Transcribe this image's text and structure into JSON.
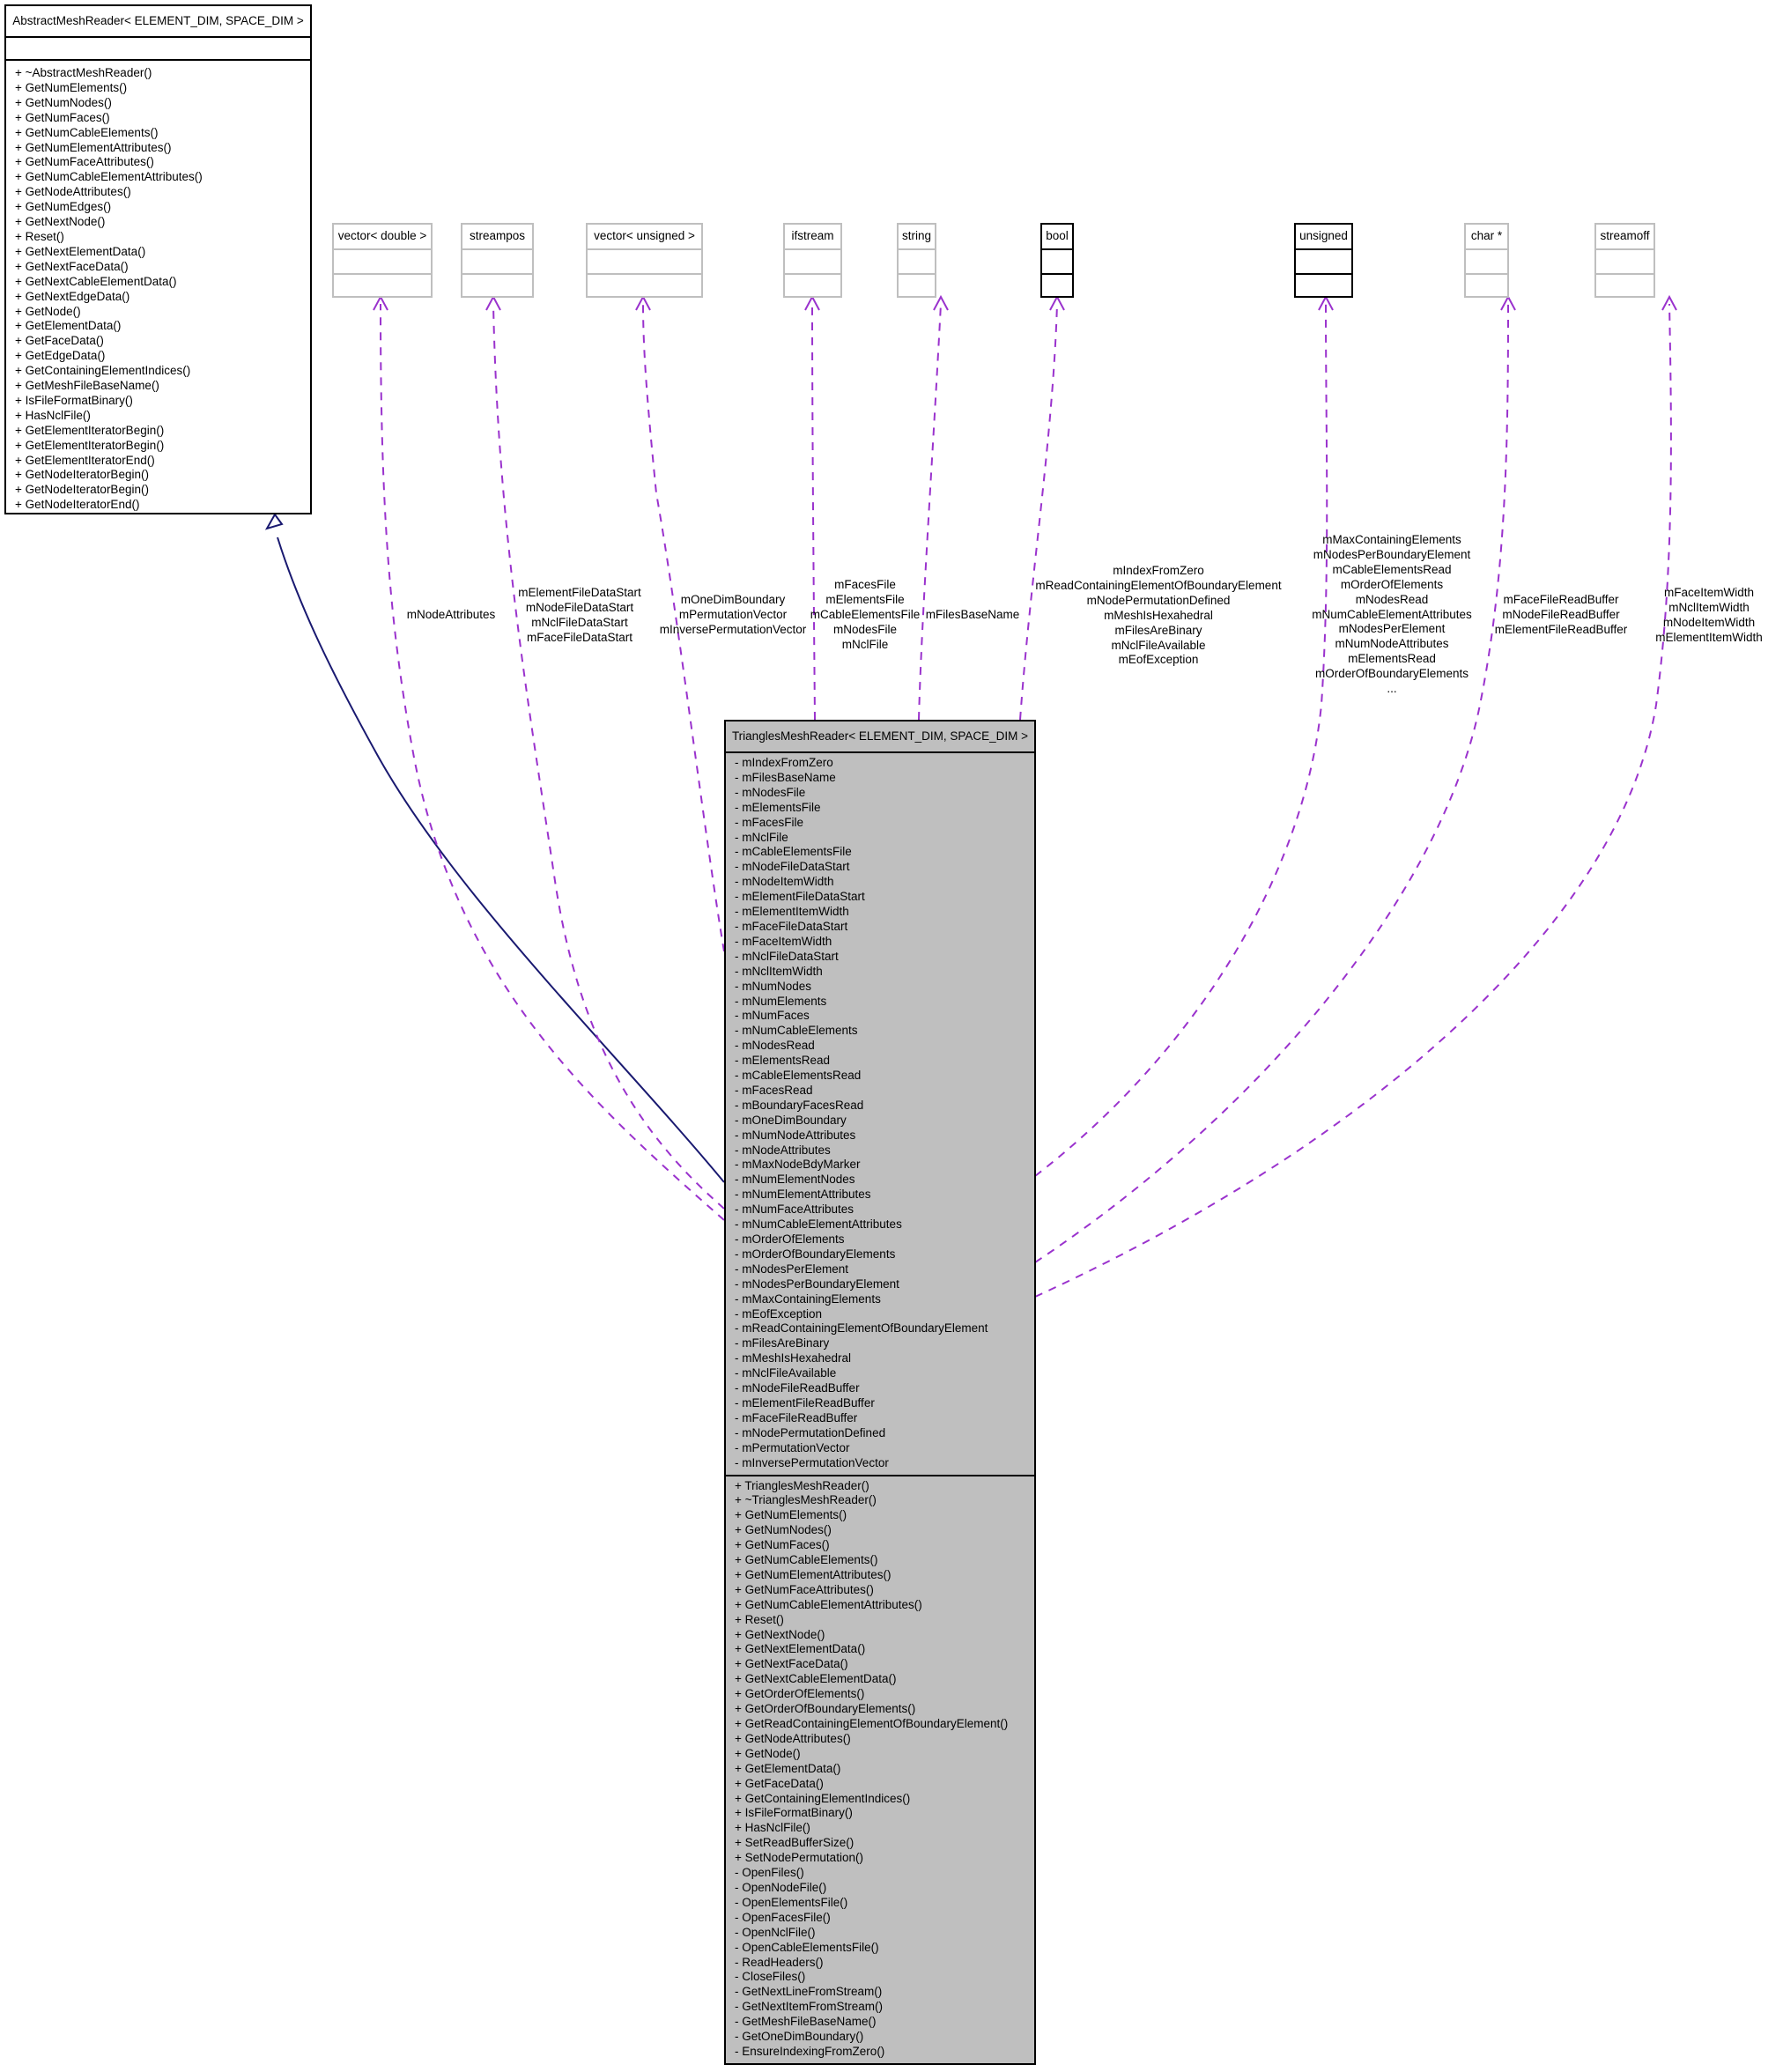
{
  "base_class": {
    "title": "AbstractMeshReader< ELEMENT_DIM, SPACE_DIM >",
    "attributes": [],
    "methods": [
      "+ ~AbstractMeshReader()",
      "+ GetNumElements()",
      "+ GetNumNodes()",
      "+ GetNumFaces()",
      "+ GetNumCableElements()",
      "+ GetNumElementAttributes()",
      "+ GetNumFaceAttributes()",
      "+ GetNumCableElementAttributes()",
      "+ GetNodeAttributes()",
      "+ GetNumEdges()",
      "+ GetNextNode()",
      "+ Reset()",
      "+ GetNextElementData()",
      "+ GetNextFaceData()",
      "+ GetNextCableElementData()",
      "+ GetNextEdgeData()",
      "+ GetNode()",
      "+ GetElementData()",
      "+ GetFaceData()",
      "+ GetEdgeData()",
      "+ GetContainingElementIndices()",
      "+ GetMeshFileBaseName()",
      "+ IsFileFormatBinary()",
      "+ HasNclFile()",
      "+ GetElementIteratorBegin()",
      "+ GetElementIteratorBegin()",
      "+ GetElementIteratorEnd()",
      "+ GetNodeIteratorBegin()",
      "+ GetNodeIteratorBegin()",
      "+ GetNodeIteratorEnd()"
    ]
  },
  "type_boxes": [
    {
      "id": "vector-double",
      "title": "vector< double >",
      "style": "gray"
    },
    {
      "id": "streampos",
      "title": "streampos",
      "style": "gray"
    },
    {
      "id": "vector-unsigned",
      "title": "vector< unsigned >",
      "style": "gray"
    },
    {
      "id": "ifstream",
      "title": "ifstream",
      "style": "gray"
    },
    {
      "id": "string",
      "title": "string",
      "style": "gray"
    },
    {
      "id": "bool",
      "title": "bool",
      "style": "black"
    },
    {
      "id": "unsigned",
      "title": "unsigned",
      "style": "black"
    },
    {
      "id": "char-ptr",
      "title": "char *",
      "style": "gray"
    },
    {
      "id": "streamoff",
      "title": "streamoff",
      "style": "gray"
    }
  ],
  "edge_labels": {
    "vector-double": [
      "mNodeAttributes"
    ],
    "streampos": [
      "mElementFileDataStart",
      "mNodeFileDataStart",
      "mNclFileDataStart",
      "mFaceFileDataStart"
    ],
    "vector-unsigned": [
      "mOneDimBoundary",
      "mPermutationVector",
      "mInversePermutationVector"
    ],
    "ifstream": [
      "mFacesFile",
      "mElementsFile",
      "mCableElementsFile",
      "mNodesFile",
      "mNclFile"
    ],
    "string": [
      "mFilesBaseName"
    ],
    "bool": [
      "mIndexFromZero",
      "mReadContainingElementOfBoundaryElement",
      "mNodePermutationDefined",
      "mMeshIsHexahedral",
      "mFilesAreBinary",
      "mNclFileAvailable",
      "mEofException"
    ],
    "unsigned": [
      "mMaxContainingElements",
      "mNodesPerBoundaryElement",
      "mCableElementsRead",
      "mOrderOfElements",
      "mNodesRead",
      "mNumCableElementAttributes",
      "mNodesPerElement",
      "mNumNodeAttributes",
      "mElementsRead",
      "mOrderOfBoundaryElements",
      "..."
    ],
    "char-ptr": [
      "mFaceFileReadBuffer",
      "mNodeFileReadBuffer",
      "mElementFileReadBuffer"
    ],
    "streamoff": [
      "mFaceItemWidth",
      "mNclItemWidth",
      "mNodeItemWidth",
      "mElementItemWidth"
    ]
  },
  "main_class": {
    "title": "TrianglesMeshReader< ELEMENT_DIM, SPACE_DIM >",
    "attributes": [
      "- mIndexFromZero",
      "- mFilesBaseName",
      "- mNodesFile",
      "- mElementsFile",
      "- mFacesFile",
      "- mNclFile",
      "- mCableElementsFile",
      "- mNodeFileDataStart",
      "- mNodeItemWidth",
      "- mElementFileDataStart",
      "- mElementItemWidth",
      "- mFaceFileDataStart",
      "- mFaceItemWidth",
      "- mNclFileDataStart",
      "- mNclItemWidth",
      "- mNumNodes",
      "- mNumElements",
      "- mNumFaces",
      "- mNumCableElements",
      "- mNodesRead",
      "- mElementsRead",
      "- mCableElementsRead",
      "- mFacesRead",
      "- mBoundaryFacesRead",
      "- mOneDimBoundary",
      "- mNumNodeAttributes",
      "- mNodeAttributes",
      "- mMaxNodeBdyMarker",
      "- mNumElementNodes",
      "- mNumElementAttributes",
      "- mNumFaceAttributes",
      "- mNumCableElementAttributes",
      "- mOrderOfElements",
      "- mOrderOfBoundaryElements",
      "- mNodesPerElement",
      "- mNodesPerBoundaryElement",
      "- mMaxContainingElements",
      "- mEofException",
      "- mReadContainingElementOfBoundaryElement",
      "- mFilesAreBinary",
      "- mMeshIsHexahedral",
      "- mNclFileAvailable",
      "- mNodeFileReadBuffer",
      "- mElementFileReadBuffer",
      "- mFaceFileReadBuffer",
      "- mNodePermutationDefined",
      "- mPermutationVector",
      "- mInversePermutationVector"
    ],
    "methods": [
      "+ TrianglesMeshReader()",
      "+ ~TrianglesMeshReader()",
      "+ GetNumElements()",
      "+ GetNumNodes()",
      "+ GetNumFaces()",
      "+ GetNumCableElements()",
      "+ GetNumElementAttributes()",
      "+ GetNumFaceAttributes()",
      "+ GetNumCableElementAttributes()",
      "+ Reset()",
      "+ GetNextNode()",
      "+ GetNextElementData()",
      "+ GetNextFaceData()",
      "+ GetNextCableElementData()",
      "+ GetOrderOfElements()",
      "+ GetOrderOfBoundaryElements()",
      "+ GetReadContainingElementOfBoundaryElement()",
      "+ GetNodeAttributes()",
      "+ GetNode()",
      "+ GetElementData()",
      "+ GetFaceData()",
      "+ GetContainingElementIndices()",
      "+ IsFileFormatBinary()",
      "+ HasNclFile()",
      "+ SetReadBufferSize()",
      "+ SetNodePermutation()",
      "- OpenFiles()",
      "- OpenNodeFile()",
      "- OpenElementsFile()",
      "- OpenFacesFile()",
      "- OpenNclFile()",
      "- OpenCableElementsFile()",
      "- ReadHeaders()",
      "- CloseFiles()",
      "- GetNextLineFromStream()",
      "- GetNextItemFromStream()",
      "- GetMeshFileBaseName()",
      "- GetOneDimBoundary()",
      "- EnsureIndexingFromZero()"
    ]
  },
  "colors": {
    "inheritance_edge": "#191970",
    "usage_edge": "#9a32cd",
    "main_fill": "#bfbfbf",
    "external_border": "#bfbfbf"
  }
}
